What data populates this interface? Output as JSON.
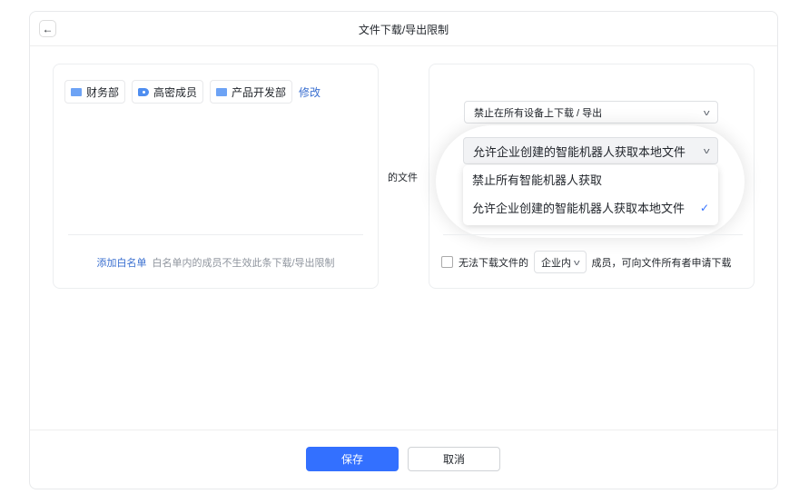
{
  "header": {
    "title": "文件下载/导出限制",
    "back_icon": "arrow-left-icon"
  },
  "whitelist": {
    "tags": [
      {
        "label": "财务部",
        "icon": "folder-icon"
      },
      {
        "label": "高密成员",
        "icon": "label-icon"
      },
      {
        "label": "产品开发部",
        "icon": "folder-icon"
      }
    ],
    "edit_label": "修改",
    "add_label": "添加白名单",
    "hint": "白名单内的成员不生效此条下载/导出限制"
  },
  "files_label": "的文件",
  "rules": {
    "download_select": "禁止在所有设备上下载 / 导出",
    "bot_select": "允许企业创建的智能机器人获取本地文件",
    "bot_options": [
      {
        "label": "禁止所有智能机器人获取",
        "selected": false
      },
      {
        "label": "允许企业创建的智能机器人获取本地文件",
        "selected": true
      }
    ],
    "request": {
      "checked": false,
      "prefix": "无法下载文件的",
      "scope": "企业内",
      "suffix": "成员，可向文件所有者申请下载"
    }
  },
  "footer": {
    "save": "保存",
    "cancel": "取消"
  },
  "colors": {
    "primary": "#3370ff",
    "link": "#3a6fd0"
  }
}
